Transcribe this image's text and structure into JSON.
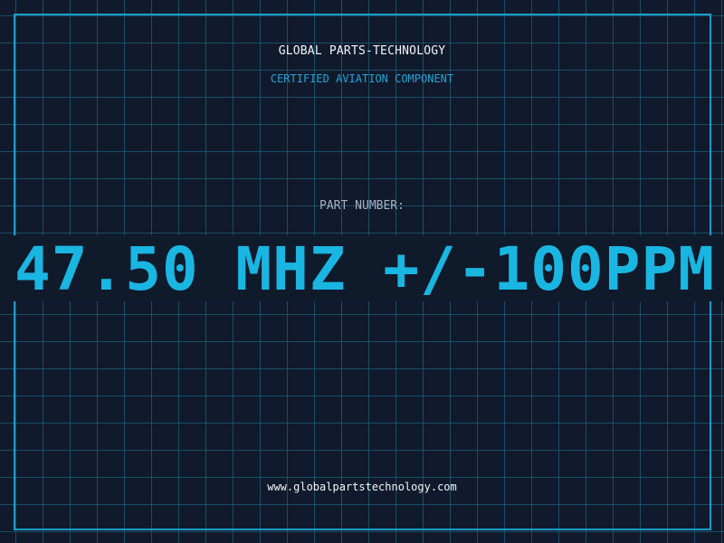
{
  "header": {
    "company_name": "GLOBAL PARTS-TECHNOLOGY",
    "certification": "CERTIFIED AVIATION COMPONENT"
  },
  "part": {
    "label": "PART NUMBER:",
    "value": "47.50 MHZ +/-100PPM"
  },
  "footer": {
    "website": "www.globalpartstechnology.com"
  },
  "colors": {
    "background": "#111a2c",
    "grid": "#1a7896",
    "accent": "#1ab6e2",
    "frame": "#1a9cc8",
    "text_primary": "#f2f4f8",
    "text_muted": "#a7b2c4"
  }
}
